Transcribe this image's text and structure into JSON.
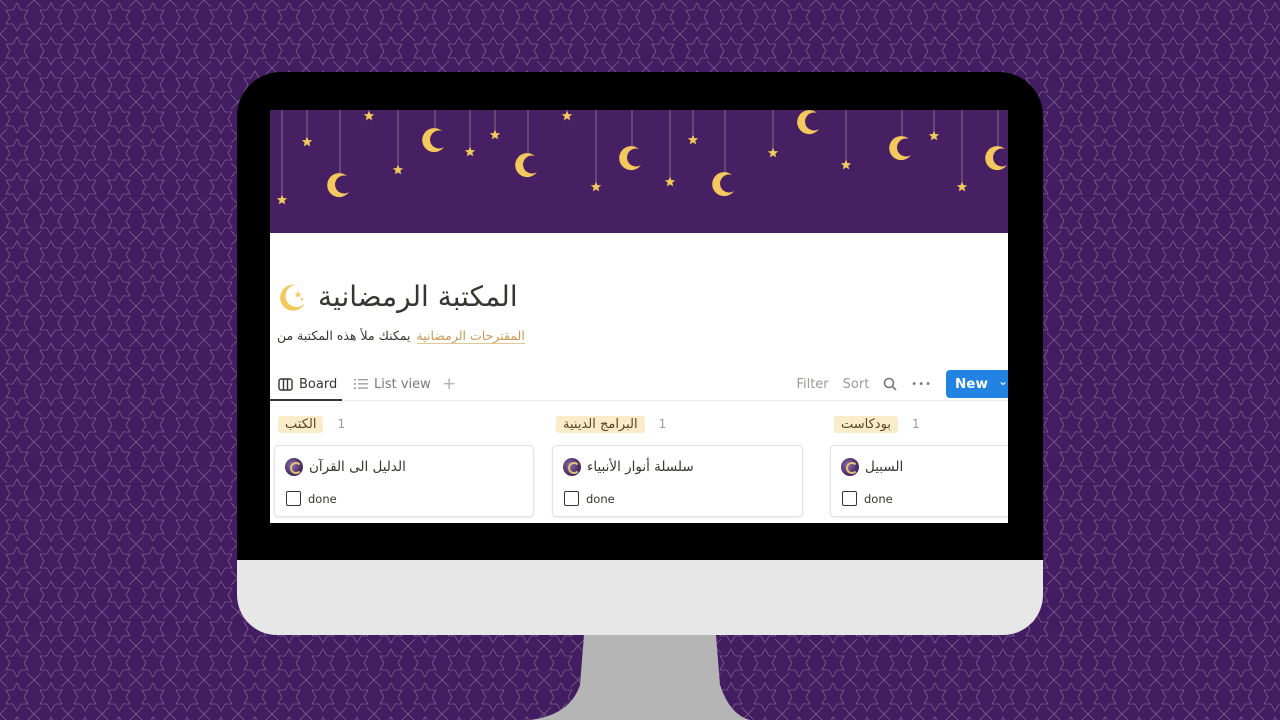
{
  "page": {
    "title": "المكتبة الرمضانية",
    "icon": "crescent-moon-stars-icon",
    "subtitle_text": "يمكنك ملأ هذه المكتبة من",
    "subtitle_link": "المقترحات الرمضانية"
  },
  "toolbar": {
    "tabs": [
      {
        "label": "Board",
        "icon": "board-icon",
        "active": true
      },
      {
        "label": "List view",
        "icon": "list-icon",
        "active": false
      }
    ],
    "add_view_label": "+",
    "filter_label": "Filter",
    "sort_label": "Sort",
    "search_icon": "search-icon",
    "more_label": "•••",
    "new_label": "New",
    "new_dropdown": "⌄"
  },
  "board": {
    "columns": [
      {
        "tag": "الكتب",
        "count": "1",
        "cards": [
          {
            "title": "الدليل الى القرآن",
            "checkbox_label": "done",
            "checked": false
          }
        ]
      },
      {
        "tag": "البرامج الدينية",
        "count": "1",
        "cards": [
          {
            "title": "سلسلة أنوار الأنبياء",
            "checkbox_label": "done",
            "checked": false
          }
        ]
      },
      {
        "tag": "بودكاست",
        "count": "1",
        "cards": [
          {
            "title": "السبيل",
            "checkbox_label": "done",
            "checked": false
          }
        ]
      }
    ]
  },
  "colors": {
    "background": "#431d62",
    "banner": "#471f63",
    "gold": "#f3c85c",
    "tag_bg": "#fbecc9",
    "accent_blue": "#2383e2",
    "link": "#c99a53"
  }
}
